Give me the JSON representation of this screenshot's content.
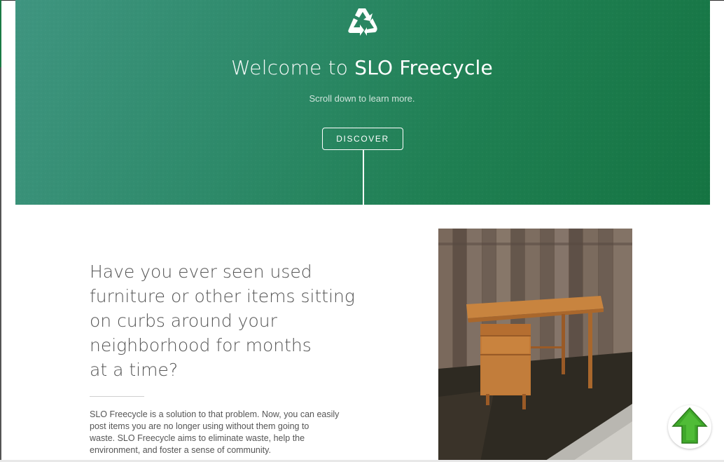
{
  "hero": {
    "icon": "recycle-icon",
    "title_prefix": "Welcome to ",
    "title_brand": "SLO Freecycle",
    "subtitle": "Scroll down to learn more.",
    "discover_label": "DISCOVER",
    "gradient_colors": [
      "#3f9580",
      "#157442"
    ]
  },
  "intro": {
    "headline_lines": [
      "Have you ever seen used",
      "furniture or other items sitting",
      "on curbs around your",
      "neighborhood for months",
      "at a time?"
    ],
    "body_lines": [
      "SLO Freecycle is a solution to that problem. Now, you can easily",
      "post items you are no longer using without them going to",
      "waste. SLO Freecycle aims to eliminate waste, help the",
      "environment, and foster a sense of community."
    ]
  },
  "photo": {
    "icon": "desk-photo"
  },
  "scroll_top": {
    "icon": "up-arrow-icon",
    "color": "#3fa82a"
  }
}
